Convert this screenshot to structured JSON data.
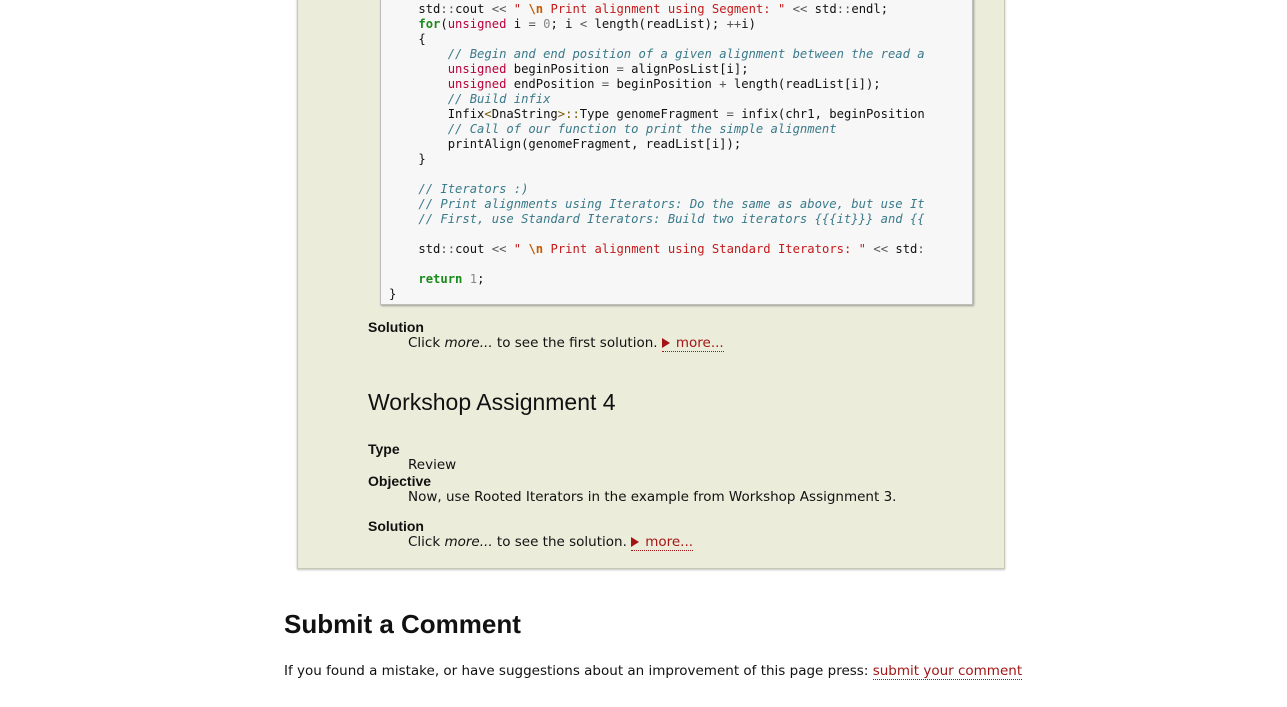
{
  "code_lines": [
    "    std::cout << \" \\n Print alignment using Segment: \" << std::endl;",
    "    for(unsigned i = 0; i < length(readList); ++i)",
    "    {",
    "        // Begin and end position of a given alignment between the read a",
    "        unsigned beginPosition = alignPosList[i];",
    "        unsigned endPosition = beginPosition + length(readList[i]);",
    "        // Build infix",
    "        Infix<DnaString>::Type genomeFragment = infix(chr1, beginPosition",
    "        // Call of our function to print the simple alignment",
    "        printAlign(genomeFragment, readList[i]);",
    "    }",
    "",
    "    // Iterators :)",
    "    // Print alignments using Iterators: Do the same as above, but use It",
    "    // First, use Standard Iterators: Build two iterators {{{it}}} and {{",
    "",
    "    std::cout << \" \\n Print alignment using Standard Iterators: \" << std:",
    "",
    "    return 1;",
    "}"
  ],
  "solution1": {
    "label": "Solution",
    "text_before": "Click ",
    "text_em": "more...",
    "text_after": " to see the first solution.",
    "link": "more..."
  },
  "assignment4": {
    "title": "Workshop Assignment 4",
    "type_label": "Type",
    "type_value": "Review",
    "objective_label": "Objective",
    "objective_value": "Now, use Rooted Iterators in the example from Workshop Assignment 3.",
    "solution_label": "Solution",
    "solution_before": "Click ",
    "solution_em": "more...",
    "solution_after": " to see the solution.",
    "solution_link": "more..."
  },
  "comment": {
    "title": "Submit a Comment",
    "text": "If you found a mistake, or have suggestions about an improvement of this page press: ",
    "link": "submit your comment"
  }
}
